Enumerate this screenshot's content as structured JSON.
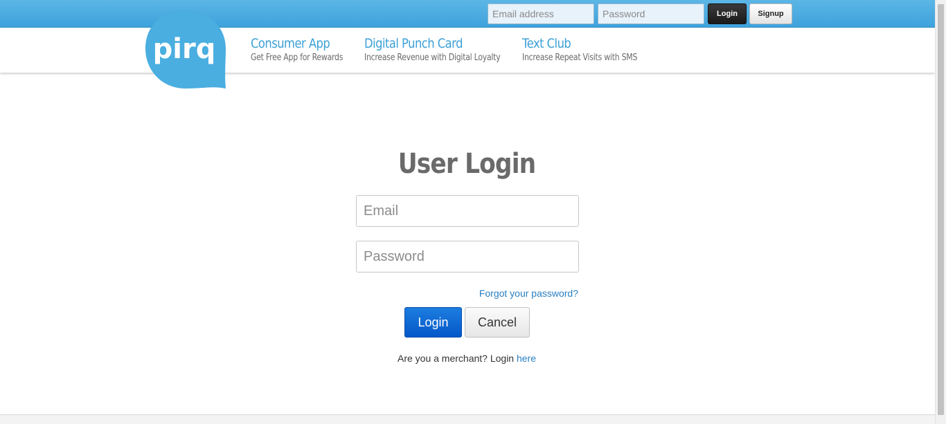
{
  "topbar": {
    "email_placeholder": "Email address",
    "password_placeholder": "Password",
    "login_label": "Login",
    "signup_label": "Signup"
  },
  "logo": {
    "text": "pirq",
    "color": "#4aaee0"
  },
  "nav": [
    {
      "title": "Consumer App",
      "subtitle": "Get Free App for Rewards"
    },
    {
      "title": "Digital Punch Card",
      "subtitle": "Increase Revenue with Digital Loyalty"
    },
    {
      "title": "Text Club",
      "subtitle": "Increase Repeat Visits with SMS"
    }
  ],
  "login": {
    "title": "User Login",
    "email_placeholder": "Email",
    "password_placeholder": "Password",
    "forgot_label": "Forgot your password?",
    "login_label": "Login",
    "cancel_label": "Cancel",
    "merchant_text": "Are you a merchant? Login",
    "merchant_link": "here"
  },
  "colors": {
    "brand_blue": "#3ea2dc",
    "link_blue": "#2a7fc0",
    "primary_button": "#0557c8"
  }
}
